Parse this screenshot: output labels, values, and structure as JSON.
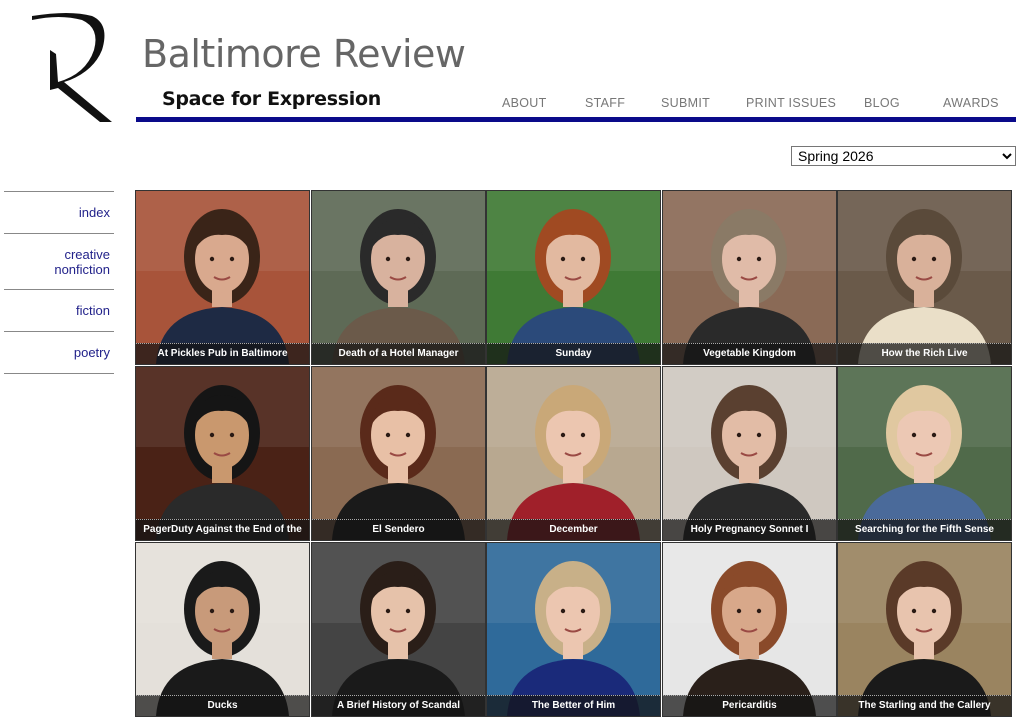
{
  "site": {
    "title": "Baltimore Review",
    "tagline": "Space for Expression",
    "logo_icon": "serif-r-logo-icon"
  },
  "nav": [
    {
      "label": "ABOUT"
    },
    {
      "label": "STAFF"
    },
    {
      "label": "SUBMIT"
    },
    {
      "label": "PRINT ISSUES"
    },
    {
      "label": "BLOG"
    },
    {
      "label": "AWARDS"
    }
  ],
  "issue_select": {
    "value": "Spring 2026"
  },
  "sidebar": [
    {
      "label": "index"
    },
    {
      "label": "creative nonfiction"
    },
    {
      "label": "fiction"
    },
    {
      "label": "poetry"
    }
  ],
  "colors": {
    "accent_rule": "#0a0a8a",
    "link": "#22228a",
    "nav_text": "#777777"
  },
  "tiles": [
    {
      "caption": "At Pickles Pub in Baltimore",
      "bg": "#a8543a",
      "hair": "#3a2418",
      "skin": "#d9a98e",
      "shirt": "#1e2a44"
    },
    {
      "caption": "Death of a Hotel Manager",
      "bg": "#5e6a56",
      "hair": "#2a2a2a",
      "skin": "#d8b29e",
      "shirt": "#6b5a4a"
    },
    {
      "caption": "Sunday",
      "bg": "#3f7a35",
      "hair": "#a04a22",
      "skin": "#e2b9a0",
      "shirt": "#2b4a7a"
    },
    {
      "caption": "Vegetable Kingdom",
      "bg": "#8a6a56",
      "hair": "#8a7a66",
      "skin": "#e0bba8",
      "shirt": "#2a2a2a"
    },
    {
      "caption": "How the Rich Live",
      "bg": "#6a5a4a",
      "hair": "#5a4a3a",
      "skin": "#d9b19a",
      "shirt": "#eadfc8"
    },
    {
      "caption": "PagerDuty Against the End of the",
      "bg": "#4a2216",
      "hair": "#151515",
      "skin": "#c9986e",
      "shirt": "#2a2a2a"
    },
    {
      "caption": "El Sendero",
      "bg": "#8a6a52",
      "hair": "#5a2a1a",
      "skin": "#e8c0a6",
      "shirt": "#1a1a1a"
    },
    {
      "caption": "December",
      "bg": "#b8a890",
      "hair": "#c9a878",
      "skin": "#ecc6b0",
      "shirt": "#a0202a"
    },
    {
      "caption": "Holy Pregnancy Sonnet I",
      "bg": "#cfc8c0",
      "hair": "#5a4030",
      "skin": "#e2bca6",
      "shirt": "#2a2a2a"
    },
    {
      "caption": "Searching for the Fifth Sense",
      "bg": "#506a4a",
      "hair": "#e0c8a0",
      "skin": "#ecc8b4",
      "shirt": "#4a6a9a"
    },
    {
      "caption": "Ducks",
      "bg": "#e4e0da",
      "hair": "#1a1a1a",
      "skin": "#c89a7a",
      "shirt": "#1a1a1a"
    },
    {
      "caption": "A Brief History of Scandal",
      "bg": "#444444",
      "hair": "#2a1e18",
      "skin": "#e6c2aa",
      "shirt": "#1a1a1a"
    },
    {
      "caption": "The Better of Him",
      "bg": "#2f6a9a",
      "hair": "#c8b088",
      "skin": "#ecc6b0",
      "shirt": "#1a2a7a"
    },
    {
      "caption": "Pericarditis",
      "bg": "#e6e6e6",
      "hair": "#8a4a2a",
      "skin": "#d8a88a",
      "shirt": "#2a201a"
    },
    {
      "caption": "The Starling and the Callery",
      "bg": "#9a8460",
      "hair": "#5a3a28",
      "skin": "#e8c4ae",
      "shirt": "#1a1a1a"
    }
  ]
}
